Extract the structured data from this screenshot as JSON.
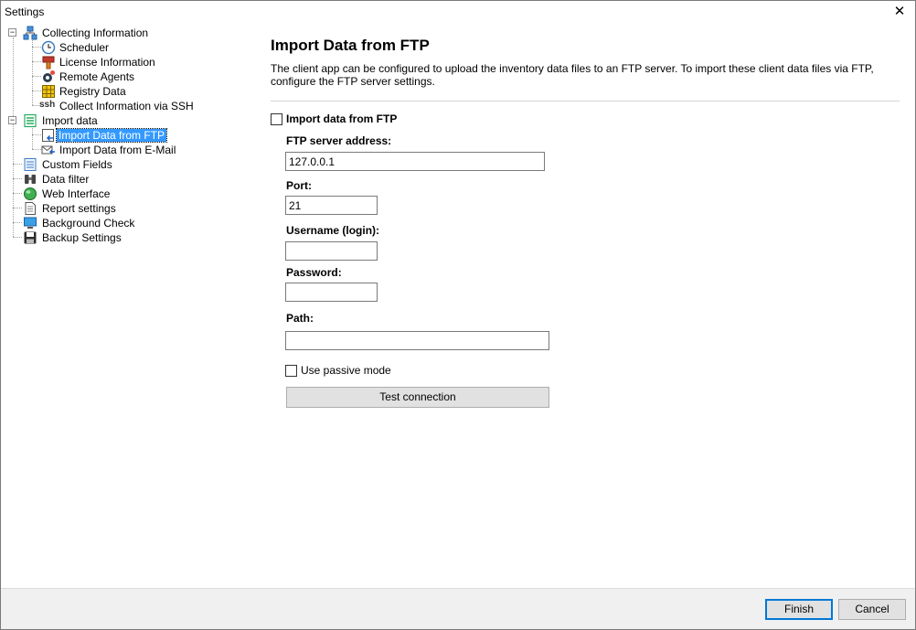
{
  "window": {
    "title": "Settings",
    "close_icon": "close-icon"
  },
  "tree": {
    "items": [
      {
        "label": "Collecting Information",
        "icon": "network-icon",
        "expanded": true
      },
      {
        "label": "Scheduler",
        "icon": "clock-icon"
      },
      {
        "label": "License Information",
        "icon": "certificate-icon"
      },
      {
        "label": "Remote Agents",
        "icon": "agent-gear-icon"
      },
      {
        "label": "Registry Data",
        "icon": "registry-grid-icon"
      },
      {
        "label": "Collect Information via SSH",
        "icon": "ssh-icon",
        "icon_text": "ssh"
      },
      {
        "label": "Import data",
        "icon": "import-icon",
        "expanded": true
      },
      {
        "label": "Import Data from FTP",
        "icon": "ftp-import-icon",
        "selected": true
      },
      {
        "label": "Import Data from E-Mail",
        "icon": "email-import-icon"
      },
      {
        "label": "Custom Fields",
        "icon": "fields-list-icon"
      },
      {
        "label": "Data filter",
        "icon": "binoculars-icon"
      },
      {
        "label": "Web Interface",
        "icon": "globe-icon"
      },
      {
        "label": "Report settings",
        "icon": "report-icon"
      },
      {
        "label": "Background Check",
        "icon": "monitor-icon"
      },
      {
        "label": "Backup Settings",
        "icon": "floppy-disk-icon"
      }
    ]
  },
  "main": {
    "title": "Import Data from FTP",
    "description": "The client app can be configured to upload the inventory data files to an FTP server. To import these client data files via FTP, configure the FTP server settings.",
    "enable_label": "Import data from FTP",
    "enable_checked": false,
    "server_label": "FTP server address:",
    "server_value": "127.0.0.1",
    "port_label": "Port:",
    "port_value": "21",
    "username_label": "Username (login):",
    "username_value": "",
    "password_label": "Password:",
    "password_value": "",
    "path_label": "Path:",
    "path_value": "",
    "passive_label": "Use passive mode",
    "passive_checked": false,
    "test_button": "Test connection"
  },
  "footer": {
    "finish_button": "Finish",
    "cancel_button": "Cancel"
  },
  "colors": {
    "selection": "#3399ff",
    "default_button_border": "#0078d7",
    "footer_bg": "#f0f0f0"
  }
}
